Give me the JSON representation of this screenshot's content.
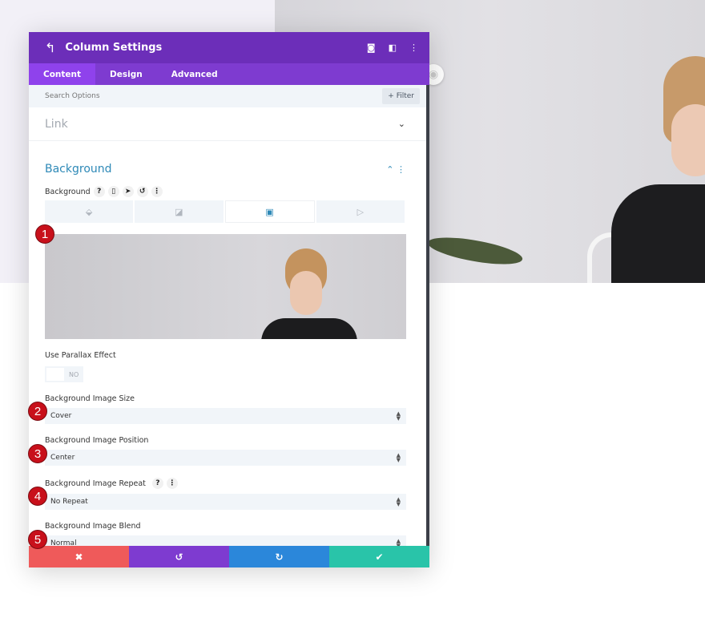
{
  "header": {
    "title": "Column Settings",
    "back_icon": "undo-arrow-icon",
    "icons": [
      "focus-icon",
      "split-view-icon",
      "more-vertical-icon"
    ]
  },
  "tabs": [
    {
      "label": "Content",
      "active": true
    },
    {
      "label": "Design"
    },
    {
      "label": "Advanced"
    }
  ],
  "search": {
    "placeholder": "Search Options",
    "filter_label": "+ Filter"
  },
  "sections": {
    "link": "Link",
    "background": "Background"
  },
  "background_field": {
    "label": "Background",
    "types": [
      "color",
      "gradient",
      "image",
      "video"
    ],
    "active_type": "image"
  },
  "parallax": {
    "label": "Use Parallax Effect",
    "value": "NO"
  },
  "fields": [
    {
      "label": "Background Image Size",
      "value": "Cover",
      "badge": "2"
    },
    {
      "label": "Background Image Position",
      "value": "Center",
      "badge": "3"
    },
    {
      "label": "Background Image Repeat",
      "value": "No Repeat",
      "badge": "4"
    },
    {
      "label": "Background Image Blend",
      "value": "Normal",
      "badge": "5"
    }
  ],
  "preview_badge": "1",
  "footer": [
    {
      "name": "cancel",
      "color": "#ef5a5a"
    },
    {
      "name": "undo",
      "color": "#7e3bd0"
    },
    {
      "name": "redo",
      "color": "#2b87da"
    },
    {
      "name": "save",
      "color": "#29c4a9"
    }
  ],
  "colors": {
    "header": "#6c2eb9",
    "tabs": "#7e3bd0",
    "accent": "#2e89b7",
    "badge": "#c8101b"
  }
}
